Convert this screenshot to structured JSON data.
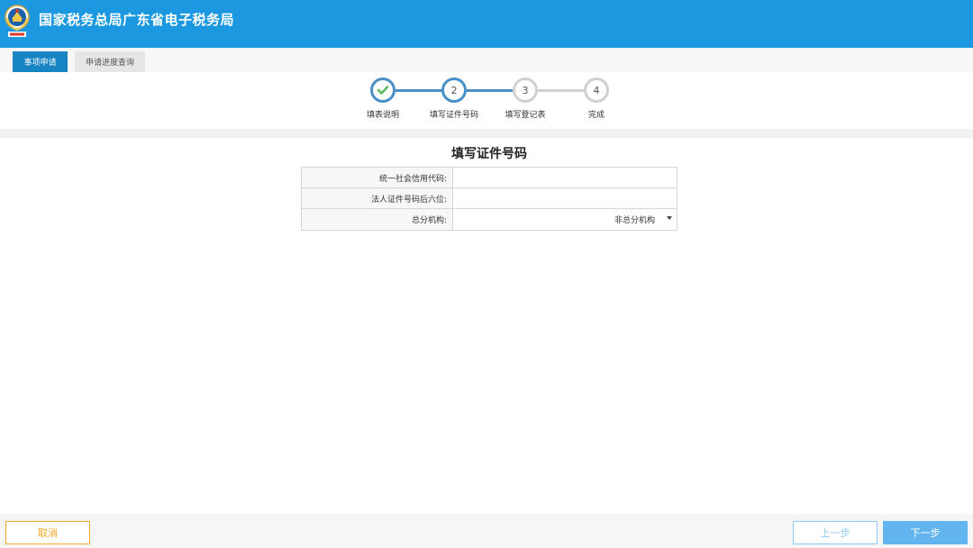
{
  "header": {
    "title": "国家税务总局广东省电子税务局",
    "emblem_icon": "tax-emblem-icon",
    "brand_color": "#1b98e0"
  },
  "tabs": [
    {
      "label": "事项申请",
      "active": true
    },
    {
      "label": "申请进度查询",
      "active": false
    }
  ],
  "steps": [
    {
      "number": "",
      "label": "填表说明",
      "status": "done",
      "icon": "check-icon"
    },
    {
      "number": "2",
      "label": "填写证件号码",
      "status": "current"
    },
    {
      "number": "3",
      "label": "填写登记表",
      "status": "pending"
    },
    {
      "number": "4",
      "label": "完成",
      "status": "pending"
    }
  ],
  "form": {
    "title": "填写证件号码",
    "fields": [
      {
        "label": "统一社会信用代码:",
        "value": "",
        "placeholder": ""
      },
      {
        "label": "法人证件号码后六位:",
        "value": "",
        "placeholder": ""
      },
      {
        "label": "总分机构:",
        "value": "非总分机构",
        "type": "select"
      }
    ]
  },
  "footer": {
    "cancel_label": "取消",
    "prev_label": "上一步",
    "next_label": "下一步"
  }
}
